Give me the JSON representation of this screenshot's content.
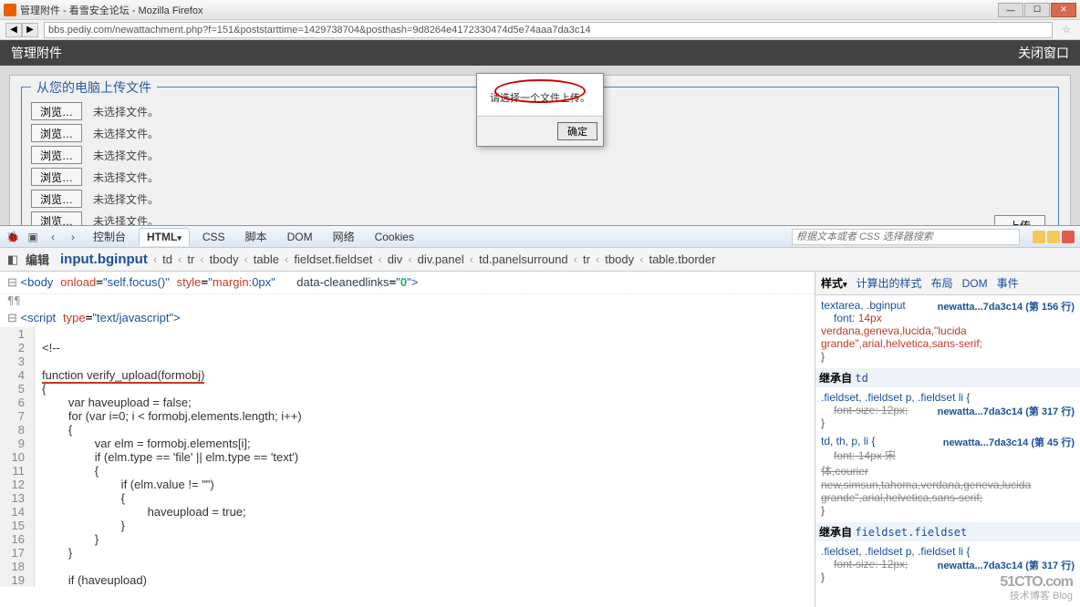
{
  "window": {
    "title": "管理附件 - 看雪安全论坛 - Mozilla Firefox",
    "url": "bbs.pediy.com/newattachment.php?f=151&poststarttime=1429738704&posthash=9d8264e4172330474d5e74aaa7da3c14"
  },
  "page": {
    "header_title": "管理附件",
    "close_window": "关闭窗口",
    "legend": "从您的电脑上传文件",
    "browse_label": "浏览…",
    "no_file": "未选择文件。",
    "upload_label": "上传",
    "file_rows": 6
  },
  "alert": {
    "message": "请选择一个文件上传。",
    "ok": "确定"
  },
  "firebug": {
    "tabs": {
      "console": "控制台",
      "html": "HTML",
      "css": "CSS",
      "script": "脚本",
      "dom": "DOM",
      "net": "网络",
      "cookies": "Cookies"
    },
    "search_placeholder": "根据文本或者 CSS 选择器搜索",
    "bc_edit": "编辑",
    "breadcrumb": [
      "input.bginput",
      "td",
      "tr",
      "tbody",
      "table",
      "fieldset.fieldset",
      "div",
      "div.panel",
      "td.panelsurround",
      "tr",
      "tbody",
      "table.tborder"
    ],
    "body_line": "<body onload=\"self.focus()\" style=\"margin:0px\" data-cleanedlinks=\"0\">",
    "script_line": "<script type=\"text/javascript\">",
    "code": [
      "",
      "<!--",
      "",
      "function verify_upload(formobj)",
      "{",
      "        var haveupload = false;",
      "        for (var i=0; i < formobj.elements.length; i++)",
      "        {",
      "                var elm = formobj.elements[i];",
      "                if (elm.type == 'file' || elm.type == 'text')",
      "                {",
      "                        if (elm.value != \"\")",
      "                        {",
      "                                haveupload = true;",
      "                        }",
      "                }",
      "        }",
      "",
      "        if (haveupload)"
    ],
    "style_tabs": {
      "style": "样式",
      "computed": "计算出的样式",
      "layout": "布局",
      "dom": "DOM",
      "events": "事件"
    },
    "rules": [
      {
        "sel": "textarea, .bginput",
        "file": "newatta...7da3c14",
        "line": "第 156 行",
        "props": [
          {
            "p": "font",
            "v": "14px verdana,geneva,lucida,\"lucida grande\",arial,helvetica,sans-serif;"
          }
        ]
      },
      {
        "inherit": "td"
      },
      {
        "sel": ".fieldset, .fieldset p, .fieldset li {",
        "file": "newatta...7da3c14",
        "line": "第 317 行",
        "props": [
          {
            "p": "font-size",
            "v": "12px;",
            "struck": true
          }
        ]
      },
      {
        "sel": "td, th, p, li {",
        "file": "newatta...7da3c14",
        "line": "第 45 行",
        "props": [
          {
            "p": "font",
            "v": "14px 宋体,courier new,simsun,tahoma,verdana,geneva,lucida grande\",arial,helvetica,sans-serif;",
            "struck": true
          }
        ]
      },
      {
        "inherit": "fieldset.fieldset"
      },
      {
        "sel": ".fieldset, .fieldset p, .fieldset li {",
        "file": "newatta...7da3c14",
        "line": "第 317 行",
        "props": [
          {
            "p": "font-size",
            "v": "12px;",
            "struck": true
          }
        ]
      }
    ]
  },
  "watermark": {
    "big": "51CTO.com",
    "small": "技术博客 Blog"
  }
}
